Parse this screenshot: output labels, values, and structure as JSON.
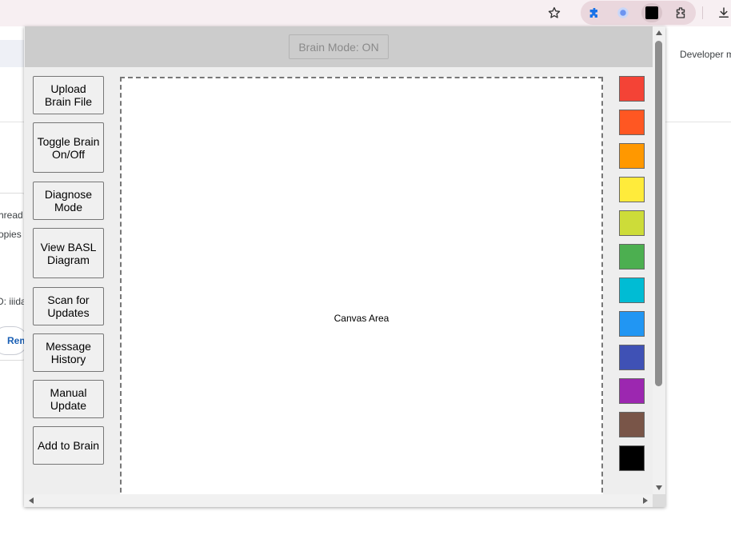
{
  "browser": {
    "icons": [
      "star-icon",
      "puzzle-extension-icon",
      "chrome-extension-icon",
      "black-square-extension-icon",
      "extensions-icon",
      "download-icon"
    ]
  },
  "background_page": {
    "right_text": "Developer m",
    "left_texts": [
      "hread",
      "opies",
      "D: iiida"
    ],
    "pill_label": "Rem"
  },
  "popup": {
    "header": {
      "brain_mode_label": "Brain Mode: ON"
    },
    "sidebar_buttons": [
      "Upload Brain File",
      "Toggle Brain On/Off",
      "Diagnose Mode",
      "View BASL Diagram",
      "Scan for Updates",
      "Message History",
      "Manual Update",
      "Add to Brain"
    ],
    "canvas_label": "Canvas Area",
    "palette": [
      "#f44336",
      "#ff5722",
      "#ff9800",
      "#ffeb3b",
      "#cddc39",
      "#4caf50",
      "#00bcd4",
      "#2196f3",
      "#3f51b5",
      "#9c27b0",
      "#795548",
      "#000000"
    ]
  }
}
